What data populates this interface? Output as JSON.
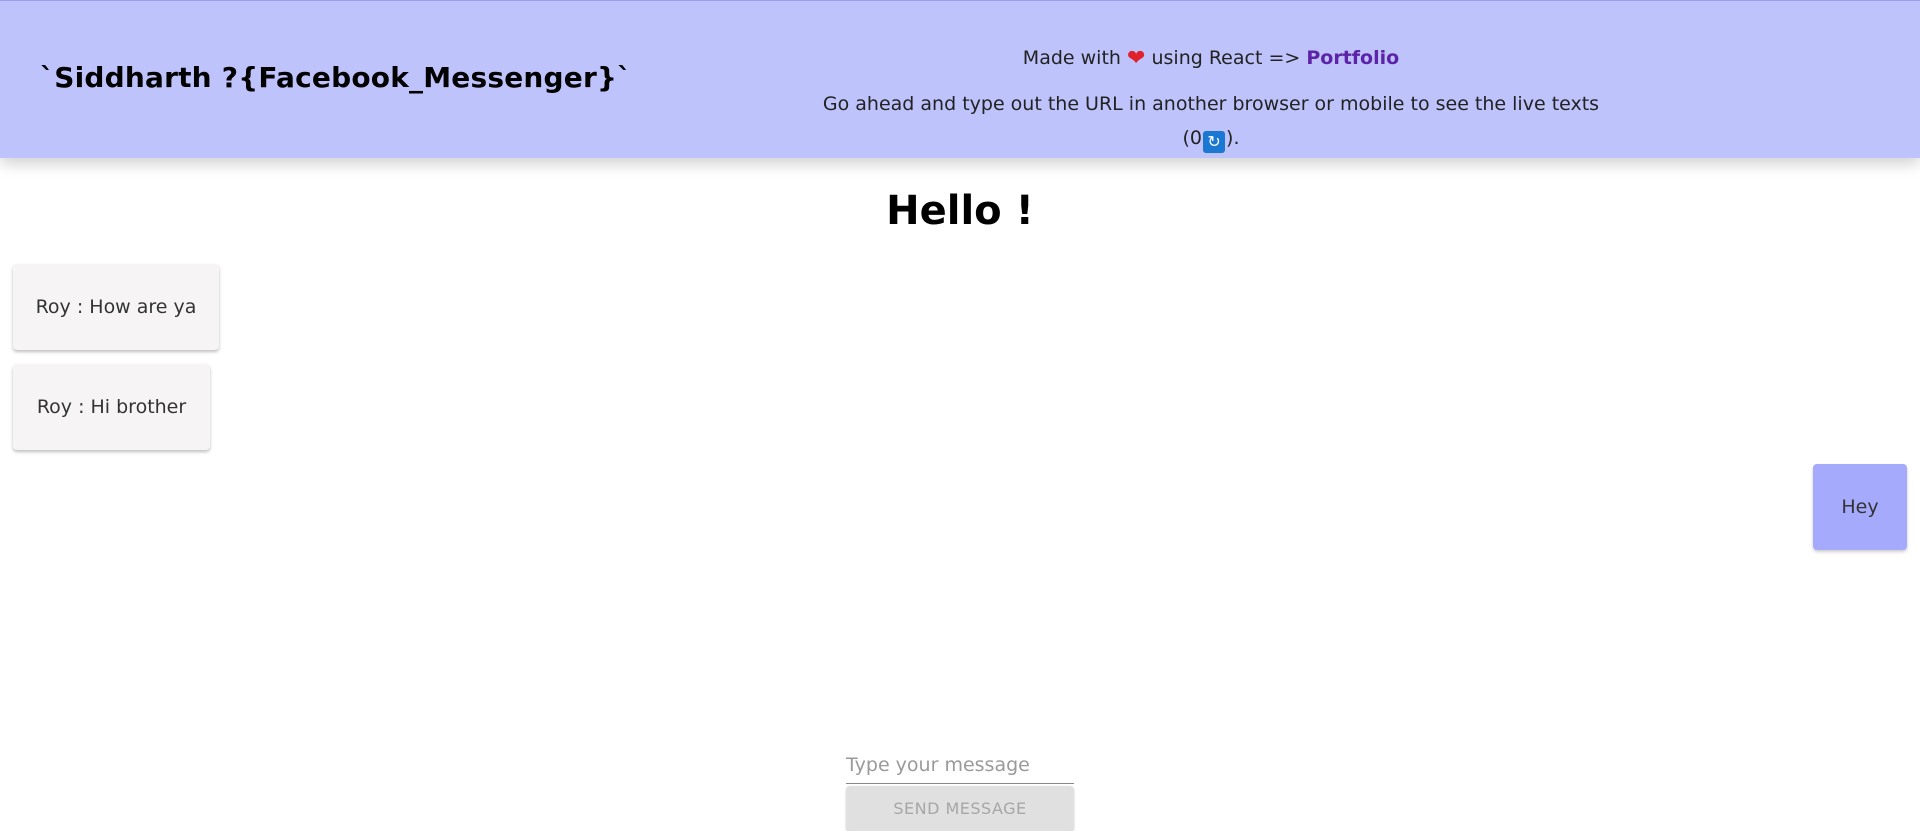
{
  "header": {
    "brand": "`Siddharth ?{Facebook_Messenger}`",
    "made_with_prefix": "Made with",
    "heart_glyph": "❤",
    "made_with_suffix": "using React =>",
    "portfolio_label": "Portfolio",
    "live_text_prefix": "Go ahead and type out the URL in another browser or mobile to see the live texts (0",
    "refresh_glyph": "🔄",
    "live_text_suffix": ")."
  },
  "greeting": "Hello !",
  "messages": [
    {
      "text": "Roy : How are ya",
      "direction": "received"
    },
    {
      "text": "Roy : Hi brother",
      "direction": "received"
    },
    {
      "text": "Hey",
      "direction": "sent"
    }
  ],
  "composer": {
    "placeholder": "Type your message",
    "value": "",
    "send_label": "SEND MESSAGE"
  },
  "colors": {
    "header_bg": "#bec3fc",
    "sent_bubble": "#a6aafd",
    "received_bubble": "#f6f4f4",
    "portfolio_link": "#5c23a8"
  },
  "icons": [
    "heart-icon",
    "refresh-icon"
  ]
}
